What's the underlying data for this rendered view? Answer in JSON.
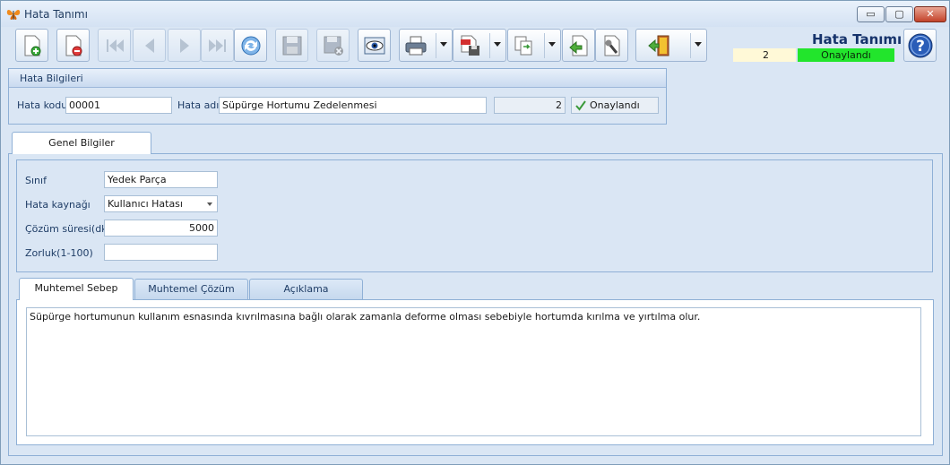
{
  "window": {
    "title": "Hata Tanımı",
    "controls": {
      "minimize": "▭",
      "maximize": "▢",
      "close": "✕"
    }
  },
  "toolbar": {
    "buttons": [
      {
        "icon": "new-document-icon",
        "enabled": true
      },
      {
        "icon": "delete-document-icon",
        "enabled": true
      },
      {
        "icon": "first-record-icon",
        "enabled": false
      },
      {
        "icon": "previous-record-icon",
        "enabled": false
      },
      {
        "icon": "next-record-icon",
        "enabled": false
      },
      {
        "icon": "last-record-icon",
        "enabled": false
      },
      {
        "icon": "refresh-icon",
        "enabled": true
      },
      {
        "icon": "save-icon",
        "enabled": false
      },
      {
        "icon": "save-close-icon",
        "enabled": false
      },
      {
        "icon": "preview-icon",
        "enabled": true
      },
      {
        "icon": "print-icon",
        "enabled": true,
        "split": true
      },
      {
        "icon": "pdf-export-icon",
        "enabled": true,
        "split": true
      },
      {
        "icon": "copy-document-icon",
        "enabled": true,
        "split": true
      },
      {
        "icon": "import-icon",
        "enabled": true
      },
      {
        "icon": "tools-icon",
        "enabled": true
      },
      {
        "icon": "exit-door-icon",
        "enabled": true,
        "split": true
      }
    ]
  },
  "header": {
    "title": "Hata Tanımı",
    "count": "2",
    "status": "Onaylandı",
    "status_color": "#22e52c"
  },
  "hata_bilgileri": {
    "group_title": "Hata Bilgileri",
    "code_label": "Hata kodu",
    "code_value": "00001",
    "name_label": "Hata adı",
    "name_value": "Süpürge Hortumu Zedelenmesi",
    "number_value": "2",
    "approved_label": "Onaylandı"
  },
  "tabs": {
    "main": "Genel Bilgiler"
  },
  "genel": {
    "sinif_label": "Sınıf",
    "sinif_value": "Yedek Parça",
    "kaynak_label": "Hata kaynağı",
    "kaynak_value": "Kullanıcı Hatası",
    "sure_label": "Çözüm süresi(dk)",
    "sure_value": "5000",
    "zorluk_label": "Zorluk(1-100)",
    "zorluk_value": ""
  },
  "subtabs": [
    {
      "label": "Muhtemel Sebep"
    },
    {
      "label": "Muhtemel Çözüm"
    },
    {
      "label": "Açıklama"
    }
  ],
  "memo": {
    "text": "Süpürge hortumunun kullanım esnasında kıvrılmasına bağlı olarak zamanla deforme olması sebebiyle hortumda kırılma ve yırtılma olur."
  }
}
